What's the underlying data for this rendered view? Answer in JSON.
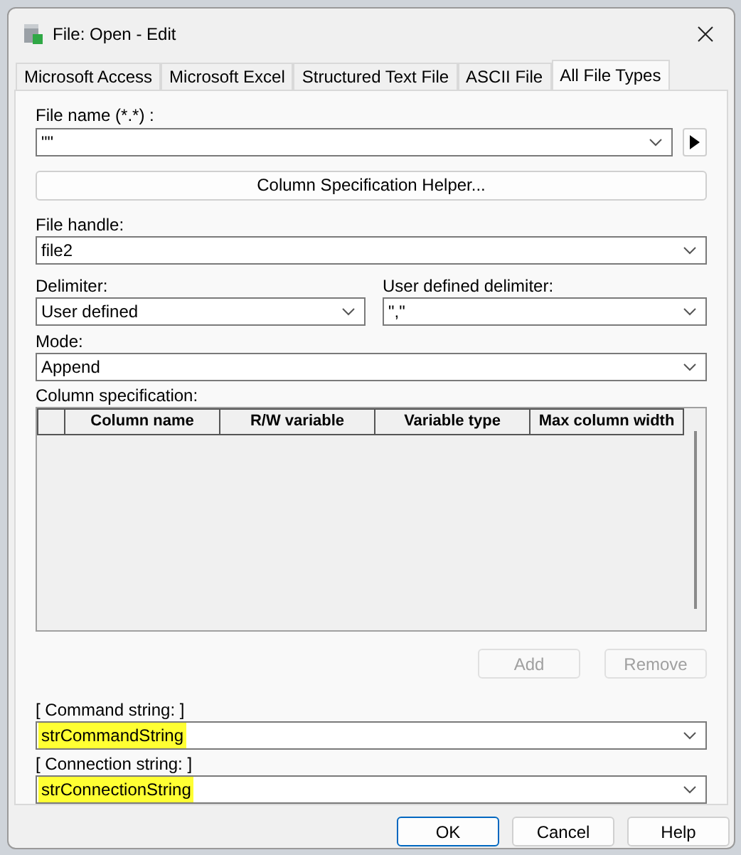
{
  "window": {
    "title": "File: Open - Edit"
  },
  "tabs": [
    {
      "label": "Microsoft Access",
      "selected": false
    },
    {
      "label": "Microsoft Excel",
      "selected": false
    },
    {
      "label": "Structured Text File",
      "selected": false
    },
    {
      "label": "ASCII File",
      "selected": false
    },
    {
      "label": "All File Types",
      "selected": true
    }
  ],
  "file_name": {
    "label": "File name (*.*) :",
    "value": "\"\""
  },
  "helper_button": "Column Specification Helper...",
  "file_handle": {
    "label": "File handle:",
    "value": "file2"
  },
  "delimiter": {
    "label": "Delimiter:",
    "value": "User defined"
  },
  "user_delimiter": {
    "label": "User defined delimiter:",
    "value": "\",\""
  },
  "mode": {
    "label": "Mode:",
    "value": "Append"
  },
  "column_spec": {
    "label": "Column specification:",
    "columns": [
      "Column name",
      "R/W variable",
      "Variable type",
      "Max column width"
    ]
  },
  "table_buttons": [
    {
      "label": "Add",
      "disabled": true
    },
    {
      "label": "Remove",
      "disabled": true
    }
  ],
  "command_string": {
    "label": "[ Command string: ]",
    "value": "strCommandString",
    "highlighted": true
  },
  "connection_string": {
    "label": "[ Connection string: ]",
    "value": "strConnectionString",
    "highlighted": true
  },
  "buttons": [
    {
      "label": "OK",
      "default": true
    },
    {
      "label": "Cancel",
      "default": false
    },
    {
      "label": "Help",
      "default": false
    }
  ]
}
